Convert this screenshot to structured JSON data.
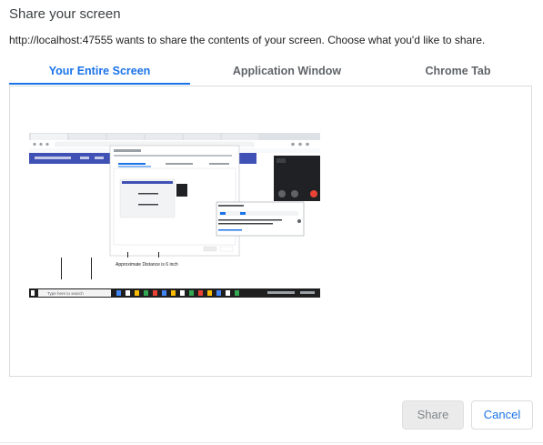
{
  "dialog": {
    "title": "Share your screen",
    "subtitle": "http://localhost:47555 wants to share the contents of your screen. Choose what you'd like to share."
  },
  "tabs": [
    {
      "label": "Your Entire Screen",
      "active": true
    },
    {
      "label": "Application Window",
      "active": false
    },
    {
      "label": "Chrome Tab",
      "active": false
    }
  ],
  "preview": {
    "caption": "Approximate Distance is 6 inch",
    "taskbar_search": "Type here to search"
  },
  "buttons": {
    "share": "Share",
    "cancel": "Cancel"
  },
  "colors": {
    "accent": "#1a73e8",
    "disabled_bg": "#ebebeb"
  }
}
